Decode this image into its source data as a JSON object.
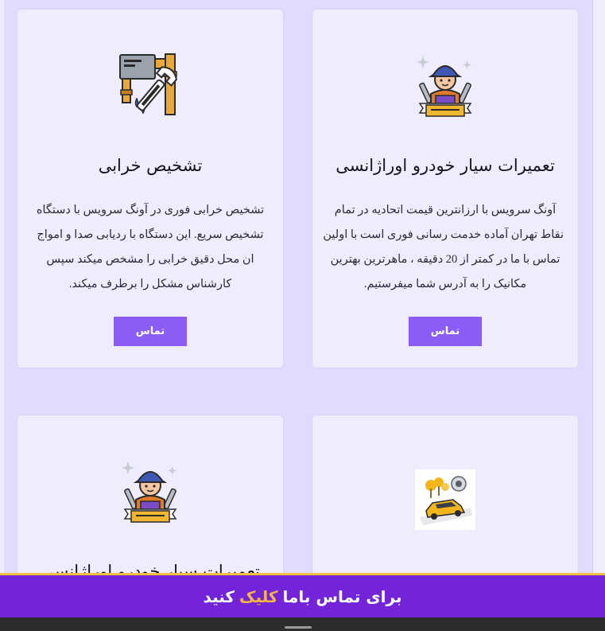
{
  "cards": [
    {
      "id": "diagnosis",
      "icon": "pipe-wrench-icon",
      "title": "تشخیص خرابی",
      "lines": [
        "تشخیص خرابی فوری در آونگ سرویس با دستگاه",
        "تشخیص سریع. این دستگاه با ردیابی صدا و امواج",
        "ان محل دقیق خرابی را مشخص میکند سپس",
        "کارشناس مشکل را برطرف میکند."
      ],
      "button": "تماس"
    },
    {
      "id": "mobile-repair",
      "icon": "mechanic-icon",
      "title": "تعمیرات سیار خودرو اوراژانسی",
      "lines": [
        "آونگ سرویس با ارزانترین قیمت اتحادیه در تمام",
        "نقاط تهران آماده خدمت رسانی فوری است با اولین",
        "تماس با ما در کمتر از 20 دقیقه ، ماهرترین بهترین",
        "مکانیک را به آدرس شما میفرستیم."
      ],
      "button": "تماس"
    },
    {
      "id": "mobile-repair-2",
      "icon": "mechanic-icon",
      "title": "تعمیرات سیار خودرو اوراژانسی"
    },
    {
      "id": "towing",
      "icon": "yellow-car-icon"
    }
  ],
  "cta": {
    "part1": "برای تماس باما",
    "highlight": "کلیک",
    "part2": "کنید"
  },
  "colors": {
    "background": "#e0dcfd",
    "card": "#efedfd",
    "button": "#8b5cf6",
    "cta_bar": "#7424d8",
    "cta_accent": "#f5b642"
  }
}
